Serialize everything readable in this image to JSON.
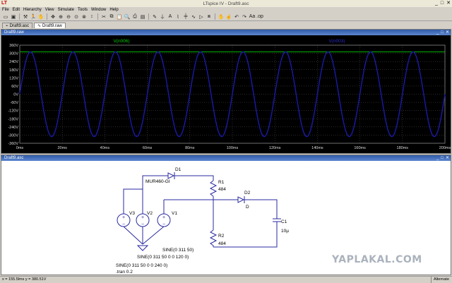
{
  "app": {
    "icon_label": "LT",
    "title": "LTspice IV - Draft9.asc",
    "win_buttons": [
      "_",
      "□",
      "✕"
    ]
  },
  "menu": [
    "File",
    "Edit",
    "Hierarchy",
    "View",
    "Simulate",
    "Tools",
    "Window",
    "Help"
  ],
  "toolbar_icons": [
    "open-icon",
    "save-icon",
    "control-panel-icon",
    "run-icon",
    "halt-icon",
    "pan-icon",
    "zoom-in-icon",
    "zoom-out-icon",
    "zoom-fit-icon",
    "zoom-cancel-icon",
    "autorange-icon",
    "cut-icon",
    "copy-icon",
    "paste-icon",
    "find-icon",
    "print-icon",
    "print-setup-icon",
    "wire-icon",
    "ground-icon",
    "label-icon",
    "resistor-icon",
    "capacitor-icon",
    "inductor-icon",
    "diode-icon",
    "component-icon",
    "move-icon",
    "drag-icon",
    "undo-icon",
    "redo-icon",
    "text-icon",
    "spice-directive-icon"
  ],
  "tabs": [
    {
      "label": "Draft9.asc",
      "active": false
    },
    {
      "label": "Draft9.raw",
      "active": true
    }
  ],
  "plot_window": {
    "title": "Draft9.raw",
    "trace_labels": {
      "left": "V(n006)",
      "right": "V(n003)"
    }
  },
  "chart_data": {
    "type": "line",
    "xlabel": "",
    "ylabel": "",
    "x_ticks": [
      "0ms",
      "20ms",
      "40ms",
      "60ms",
      "80ms",
      "100ms",
      "120ms",
      "140ms",
      "160ms",
      "180ms",
      "200ms"
    ],
    "y_ticks": [
      "360V",
      "300V",
      "240V",
      "180V",
      "120V",
      "60V",
      "0V",
      "-60V",
      "-120V",
      "-180V",
      "-240V",
      "-300V",
      "-360V"
    ],
    "xlim": [
      0,
      200
    ],
    "ylim": [
      -360,
      360
    ],
    "grid": true,
    "series": [
      {
        "name": "V(n006)",
        "color": "#00cc00",
        "kind": "flat",
        "value": 311
      },
      {
        "name": "V(n003)",
        "color": "#1a1aa8",
        "kind": "sine",
        "amplitude": 311,
        "frequency_hz": 50
      }
    ]
  },
  "schematic_window": {
    "title": "Draft9.asc",
    "components": {
      "d1": "D1",
      "d1_model": "MUR460-GI",
      "r1": "R1",
      "r1_value": "484",
      "d2": "D2",
      "d2_model": "D",
      "v1": "V1",
      "v2": "V2",
      "v3": "V3",
      "c1": "C1",
      "c1_value": "10µ",
      "r2": "R2",
      "r2_value": "484"
    },
    "source_lines": [
      "SINE(0 311 50)",
      "SINE(0 311 50 0 0 120 0)",
      "SINE(0 311 50 0 0 240 0)"
    ],
    "directive": ".tran 0.2"
  },
  "status": {
    "coords": "x = 155.5lms    y = 380.51V",
    "mode": "Alternate"
  },
  "watermark": "YAPLAKAL.COM"
}
